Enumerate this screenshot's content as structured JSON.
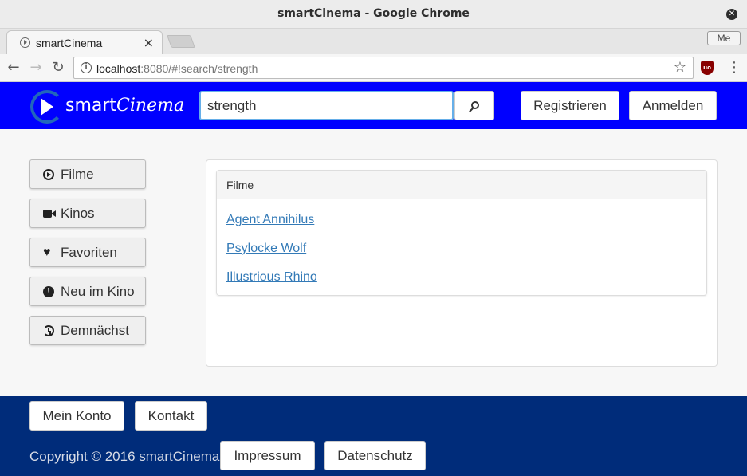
{
  "window": {
    "title": "smartCinema - Google Chrome"
  },
  "browser": {
    "tab_title": "smartCinema",
    "tab_close": "×",
    "profile_label": "Me",
    "url_host": "localhost",
    "url_rest": ":8080/#!search/strength",
    "extension_label": "uo"
  },
  "header": {
    "logo_prefix": "smart",
    "logo_suffix": "Cinema",
    "search_value": "strength",
    "register_label": "Registrieren",
    "login_label": "Anmelden"
  },
  "sidebar": {
    "items": [
      {
        "label": "Filme",
        "icon": "play-circle-icon"
      },
      {
        "label": "Kinos",
        "icon": "video-camera-icon"
      },
      {
        "label": "Favoriten",
        "icon": "heart-icon"
      },
      {
        "label": "Neu im Kino",
        "icon": "exclamation-circle-icon"
      },
      {
        "label": "Demnächst",
        "icon": "history-icon"
      }
    ]
  },
  "results": {
    "heading": "Filme",
    "items": [
      "Agent Annihilus",
      "Psylocke Wolf",
      "Illustrious Rhino"
    ]
  },
  "footer": {
    "account_label": "Mein Konto",
    "contact_label": "Kontakt",
    "copyright": "Copyright © 2016 smartCinema",
    "imprint_label": "Impressum",
    "privacy_label": "Datenschutz"
  },
  "colors": {
    "header_bg": "#0000ff",
    "footer_bg": "#002c7a",
    "link": "#337ab7"
  }
}
